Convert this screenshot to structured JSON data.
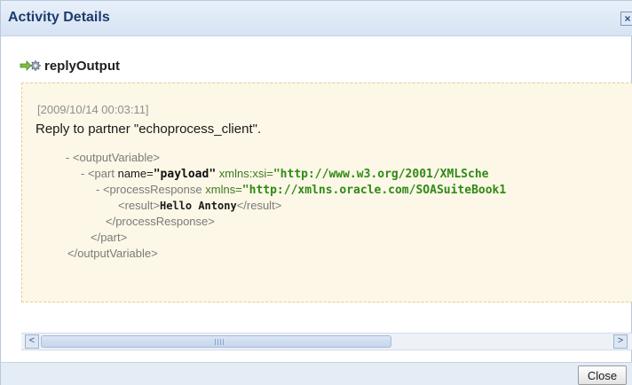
{
  "window": {
    "title": "Activity Details",
    "close_glyph": "×"
  },
  "activity": {
    "icon": "arrow-gear-icon",
    "name": "replyOutput"
  },
  "detail": {
    "timestamp": "[2009/10/14 00:03:11]",
    "message": "Reply to partner \"echoprocess_client\".",
    "xml": {
      "line1": {
        "collapse": "-",
        "open_tag": "<outputVariable>"
      },
      "line2": {
        "collapse": "-",
        "tag_start": "<part",
        "attr_name": "name=",
        "attr_value": "\"payload\"",
        "ns_attr": "xmlns:xsi=",
        "ns_value": "\"http://www.w3.org/2001/XMLSche"
      },
      "line3": {
        "collapse": "-",
        "tag_start": "<processResponse",
        "ns_attr": "xmlns=",
        "ns_value": "\"http://xmlns.oracle.com/SOASuiteBook1"
      },
      "line4": {
        "open_tag": "<result>",
        "text": "Hello Antony",
        "close_tag": "</result>"
      },
      "line5": {
        "close_tag": "</processResponse>"
      },
      "line6": {
        "close_tag": "</part>"
      },
      "line7": {
        "close_tag": "</outputVariable>"
      }
    }
  },
  "scrollbar": {
    "left_arrow": "<",
    "right_arrow": ">"
  },
  "footer": {
    "close_label": "Close"
  },
  "colors": {
    "title_text": "#1d3c6e",
    "detail_bg": "#fcf7e6",
    "namespace_green": "#2f8a16"
  }
}
